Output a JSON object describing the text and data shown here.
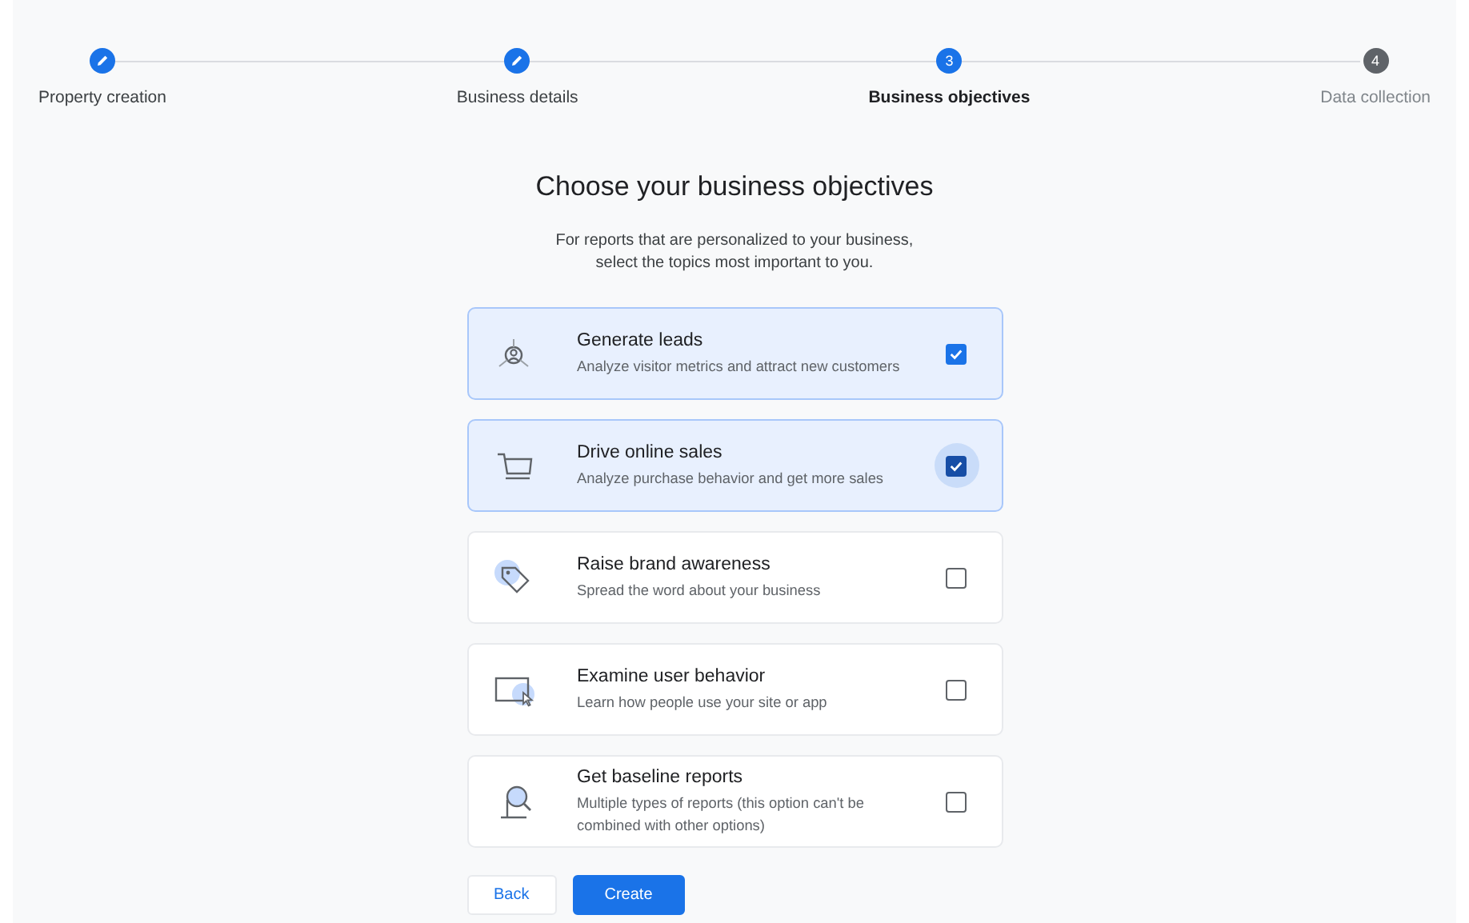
{
  "steps": [
    {
      "label": "Property creation",
      "completed": true,
      "current": false
    },
    {
      "label": "Business details",
      "completed": true,
      "current": false
    },
    {
      "label": "Business objectives",
      "completed": false,
      "current": true,
      "number": "3"
    },
    {
      "label": "Data collection",
      "completed": false,
      "current": false,
      "number": "4"
    }
  ],
  "title": "Choose your business objectives",
  "subtitle": "For reports that are personalized to your business,\nselect the topics most important to you.",
  "options": [
    {
      "title": "Generate leads",
      "description": "Analyze visitor metrics and attract new customers",
      "checked": true,
      "focused": false
    },
    {
      "title": "Drive online sales",
      "description": "Analyze purchase behavior and get more sales",
      "checked": true,
      "focused": true
    },
    {
      "title": "Raise brand awareness",
      "description": "Spread the word about your business",
      "checked": false,
      "focused": false
    },
    {
      "title": "Examine user behavior",
      "description": "Learn how people use your site or app",
      "checked": false,
      "focused": false
    },
    {
      "title": "Get baseline reports",
      "description": "Multiple types of reports (this option can't be combined with other options)",
      "checked": false,
      "focused": false
    }
  ],
  "buttons": [
    {
      "label": "Back",
      "kind": "secondary"
    },
    {
      "label": "Create",
      "kind": "primary"
    }
  ]
}
